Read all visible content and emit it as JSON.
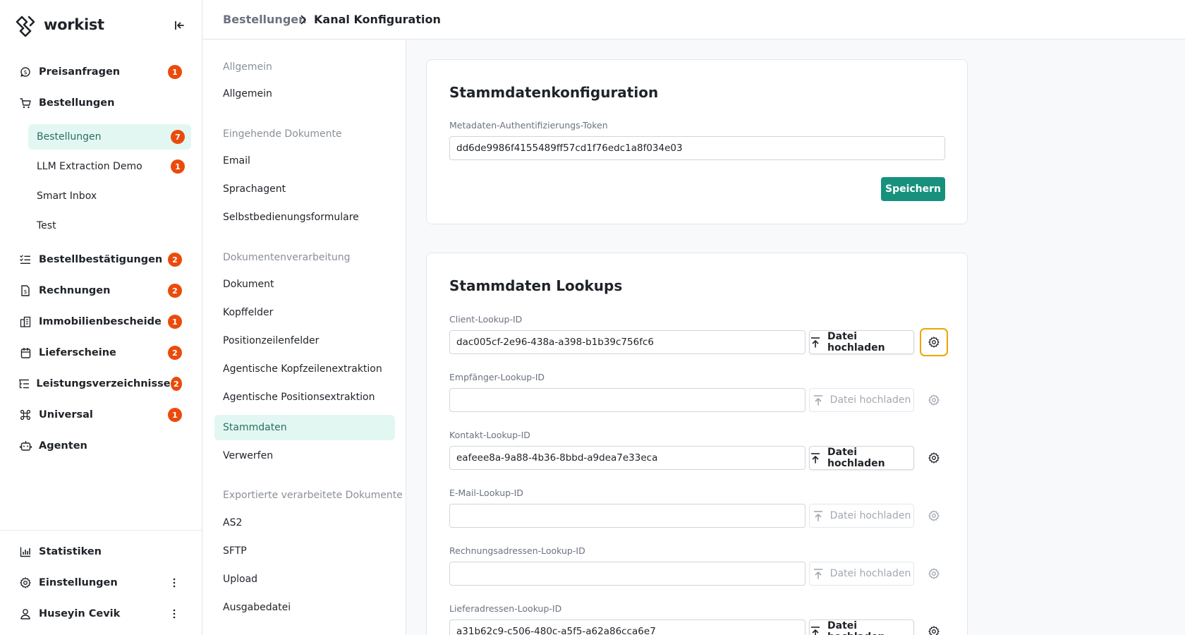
{
  "app": {
    "brand": "workist"
  },
  "sidebar": {
    "items": [
      {
        "label": "Preisanfragen",
        "badge": "1"
      },
      {
        "label": "Bestellungen"
      },
      {
        "label": "Bestellbestätigungen",
        "badge": "2"
      },
      {
        "label": "Rechnungen",
        "badge": "2"
      },
      {
        "label": "Immobilienbescheide",
        "badge": "1"
      },
      {
        "label": "Lieferscheine",
        "badge": "2"
      },
      {
        "label": "Leistungsverzeichnisse",
        "badge": "2"
      },
      {
        "label": "Universal",
        "badge": "1"
      },
      {
        "label": "Agenten"
      }
    ],
    "sub_items": [
      {
        "label": "Bestellungen",
        "badge": "7"
      },
      {
        "label": "LLM Extraction Demo",
        "badge": "1"
      },
      {
        "label": "Smart Inbox"
      },
      {
        "label": "Test"
      }
    ],
    "bottom": {
      "statistics": "Statistiken",
      "settings": "Einstellungen",
      "user": "Huseyin Cevik"
    }
  },
  "breadcrumb": {
    "parent": "Bestellungen",
    "current": "Kanal Konfiguration"
  },
  "settings_nav": {
    "sections": [
      {
        "heading": "Allgemein",
        "items": [
          "Allgemein"
        ]
      },
      {
        "heading": "Eingehende Dokumente",
        "items": [
          "Email",
          "Sprachagent",
          "Selbstbedienungsformulare"
        ]
      },
      {
        "heading": "Dokumentenverarbeitung",
        "items": [
          "Dokument",
          "Kopffelder",
          "Positionzeilenfelder",
          "Agentische Kopfzeilenextraktion",
          "Agentische Positionsextraktion",
          "Stammdaten",
          "Verwerfen"
        ]
      },
      {
        "heading": "Exportierte verarbeitete Dokumente",
        "items": [
          "AS2",
          "SFTP",
          "Upload",
          "Ausgabedatei"
        ]
      }
    ],
    "active": "Stammdaten"
  },
  "master_config": {
    "title": "Stammdatenkonfiguration",
    "token_label": "Metadaten-Authentifizierungs-Token",
    "token_value": "dd6de9986f4155489ff57cd1f76edc1a8f034e03",
    "save_label": "Speichern"
  },
  "lookups": {
    "title": "Stammdaten Lookups",
    "upload_label": "Datei hochladen",
    "fields": [
      {
        "label": "Client-Lookup-ID",
        "value": "dac005cf-2e96-438a-a398-b1b39c756fc6"
      },
      {
        "label": "Empfänger-Lookup-ID",
        "value": ""
      },
      {
        "label": "Kontakt-Lookup-ID",
        "value": "eafeee8a-9a88-4b36-8bbd-a9dea7e33eca"
      },
      {
        "label": "E-Mail-Lookup-ID",
        "value": ""
      },
      {
        "label": "Rechnungsadressen-Lookup-ID",
        "value": ""
      },
      {
        "label": "Lieferadressen-Lookup-ID",
        "value": "a31b62c9-c506-480c-a5f5-a62a86cca6e7"
      }
    ]
  },
  "colors": {
    "accent": "#17917d",
    "badge": "#ea4b0c",
    "active_bg": "#e3f7f2",
    "focus_ring": "#f0a400"
  }
}
